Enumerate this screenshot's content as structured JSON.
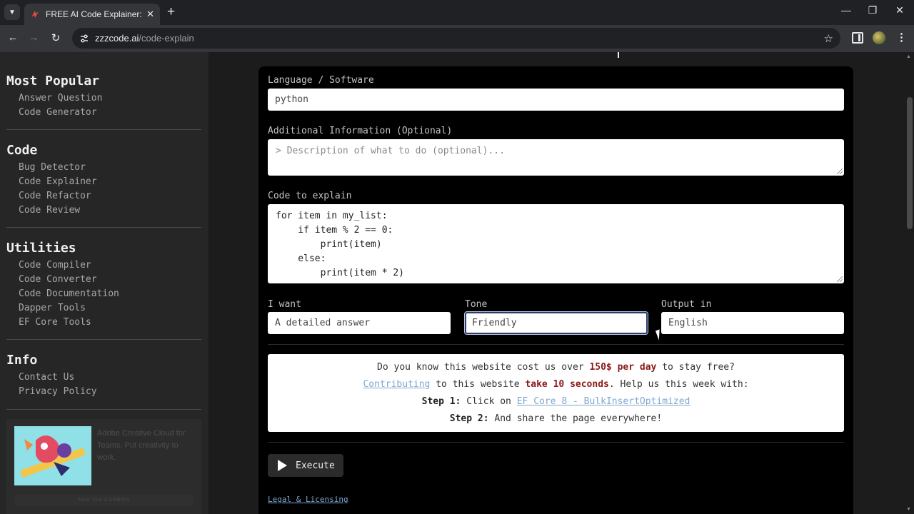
{
  "browser": {
    "tab_title": "FREE AI Code Explainer: Explain",
    "url_host": "zzzcode.ai",
    "url_path": "/code-explain",
    "tab_close": "✕",
    "new_tab": "+",
    "minimize": "—",
    "maximize": "❐",
    "close": "✕"
  },
  "sidebar": {
    "sections": [
      {
        "title": "Most Popular",
        "links": [
          "Answer Question",
          "Code Generator"
        ]
      },
      {
        "title": "Code",
        "links": [
          "Bug Detector",
          "Code Explainer",
          "Code Refactor",
          "Code Review"
        ]
      },
      {
        "title": "Utilities",
        "links": [
          "Code Compiler",
          "Code Converter",
          "Code Documentation",
          "Dapper Tools",
          "EF Core Tools"
        ]
      },
      {
        "title": "Info",
        "links": [
          "Contact Us",
          "Privacy Policy"
        ]
      }
    ],
    "ad": {
      "text": "Adobe Creative Cloud for Teams. Put creativity to work.",
      "via": "ADS VIA CARBON"
    }
  },
  "form": {
    "language_label": "Language / Software",
    "language_value": "python",
    "additional_label": "Additional Information (Optional)",
    "additional_placeholder": "> Description of what to do (optional)...",
    "code_label": "Code to explain",
    "code_lines": [
      "for item in my_list:",
      "    if item % 2 == 0:",
      "        print(item)",
      "    else:",
      "        print(item * 2)"
    ],
    "want_label": "I want",
    "want_value": "A detailed answer",
    "tone_label": "Tone",
    "tone_value": "Friendly",
    "output_label": "Output in",
    "output_value": "English"
  },
  "notice": {
    "line1_pre": "Do you know this website cost us over ",
    "line1_strong": "150$ per day",
    "line1_post": " to stay free?",
    "line2_link": "Contributing",
    "line2_mid": " to this website ",
    "line2_strong": "take 10 seconds",
    "line2_post": ". Help us this week with:",
    "step1_label": "Step 1:",
    "step1_text": " Click on ",
    "step1_link": "EF Core 8 - BulkInsertOptimized",
    "step2_label": "Step 2:",
    "step2_text": " And share the page everywhere!"
  },
  "execute_label": "Execute",
  "legal_label": "Legal & Licensing"
}
